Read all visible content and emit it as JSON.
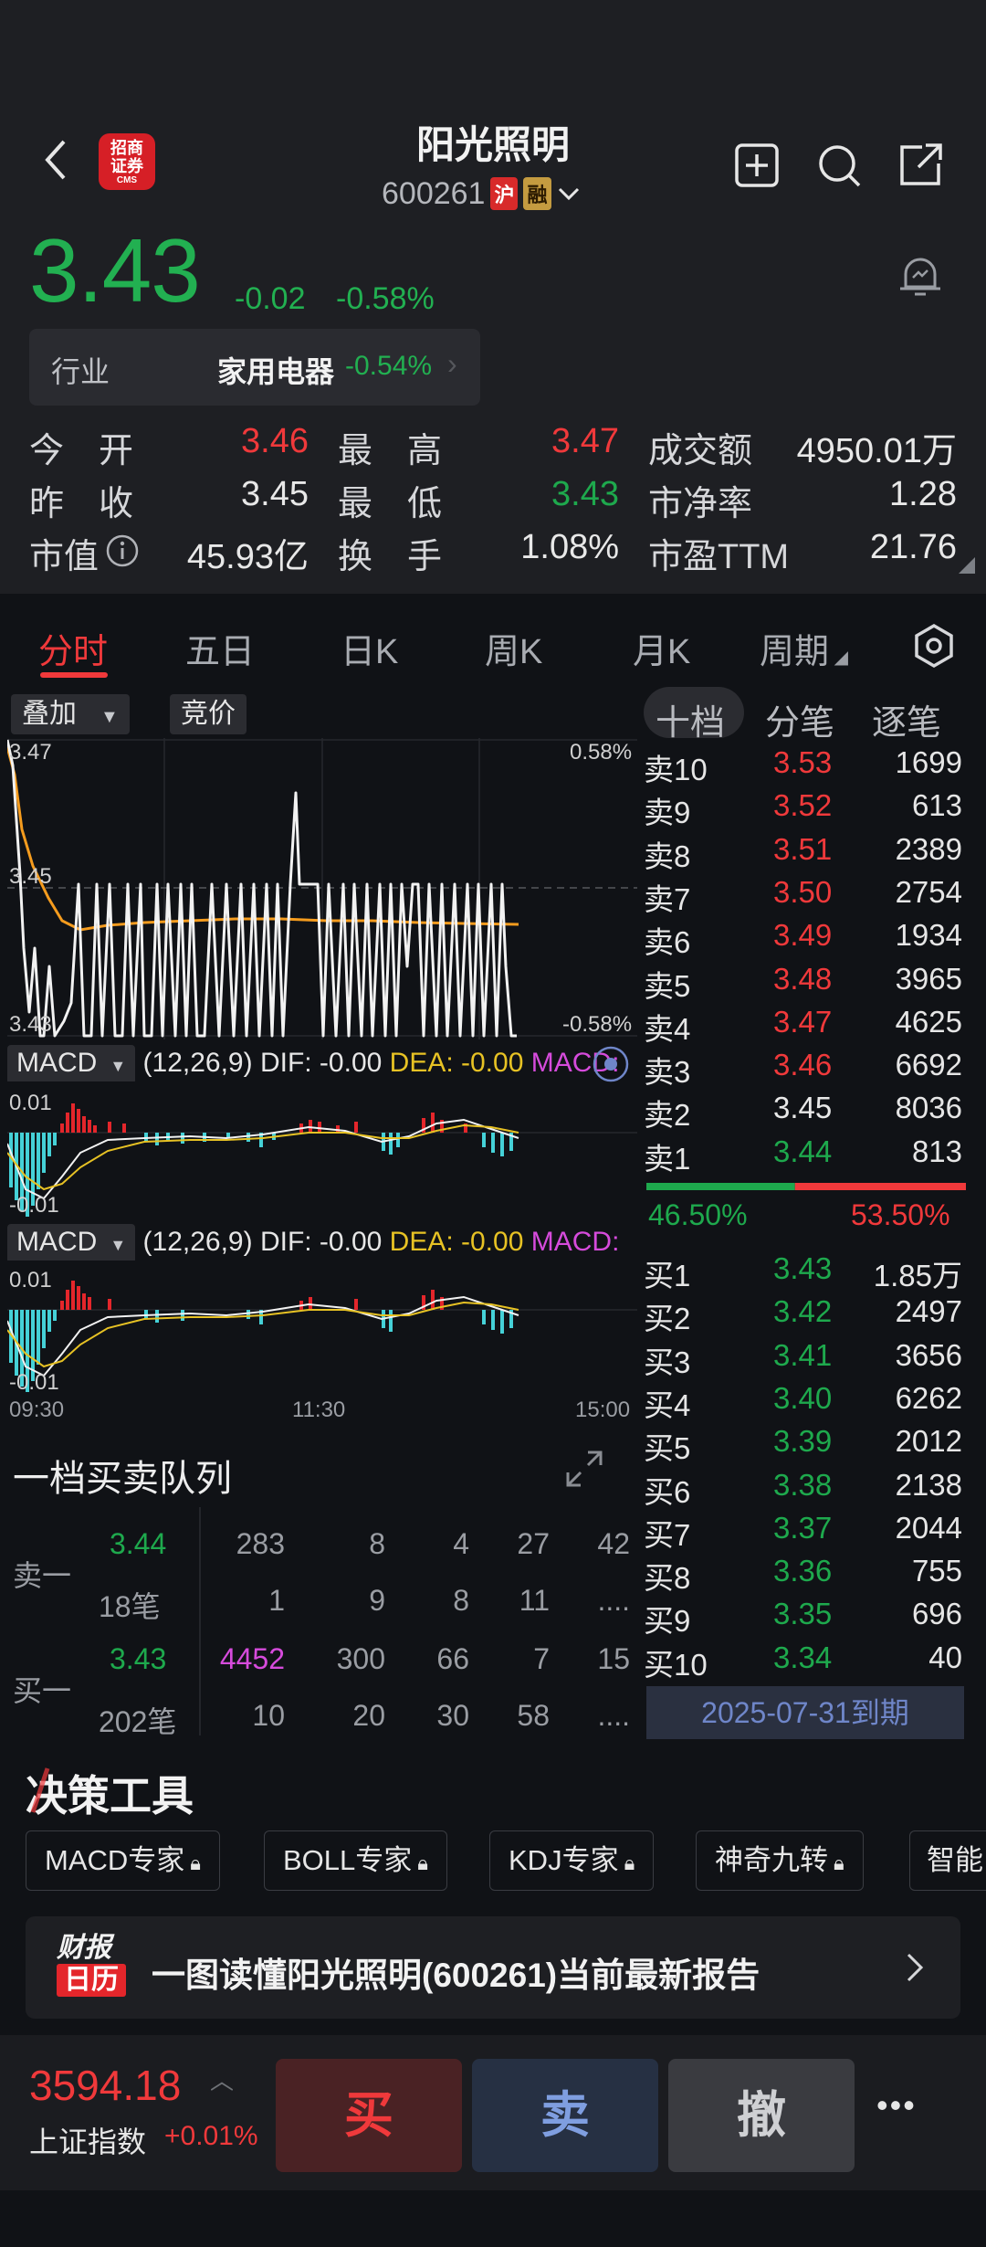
{
  "header": {
    "stock_name": "阳光照明",
    "stock_code": "600261",
    "tag_market": "沪",
    "tag_margin": "融",
    "logo_text": "招商证券",
    "logo_sub": "CMS"
  },
  "quote": {
    "price": "3.43",
    "change": "-0.02",
    "change_pct": "-0.58%",
    "industry_label": "行业",
    "industry_name": "家用电器",
    "industry_change": "-0.54%",
    "rows": [
      {
        "l1": "今　开",
        "v1": "3.46",
        "l2": "最　高",
        "v2": "3.47",
        "l3": "成交额",
        "v3": "4950.01万"
      },
      {
        "l1": "昨　收",
        "v1": "3.45",
        "l2": "最　低",
        "v2": "3.43",
        "l3": "市净率",
        "v3": "1.28"
      },
      {
        "l1": "市值",
        "v1": "45.93亿",
        "l2": "换　手",
        "v2": "1.08%",
        "l3": "市盈TTM",
        "v3": "21.76"
      }
    ]
  },
  "tabs": [
    "分时",
    "五日",
    "日K",
    "周K",
    "月K",
    "周期"
  ],
  "chart": {
    "overlay_label": "叠加",
    "auction_label": "竞价",
    "y_top": "3.47",
    "y_mid": "3.45",
    "y_bottom": "3.43",
    "pct_top": "0.58%",
    "pct_bottom": "-0.58%",
    "macd_label": "MACD",
    "macd_params": "(12,26,9)",
    "dif": "DIF: -0.00",
    "dea": "DEA: -0.00",
    "macd_val": "MACD:",
    "macd_top": "0.01",
    "macd_bottom": "-0.01",
    "time_start": "09:30",
    "time_mid": "11:30",
    "time_end": "15:00"
  },
  "orderbook": {
    "tabs": [
      "十档",
      "分笔",
      "逐笔"
    ],
    "sells": [
      {
        "label": "卖10",
        "price": "3.53",
        "vol": "1699"
      },
      {
        "label": "卖9",
        "price": "3.52",
        "vol": "613"
      },
      {
        "label": "卖8",
        "price": "3.51",
        "vol": "2389"
      },
      {
        "label": "卖7",
        "price": "3.50",
        "vol": "2754"
      },
      {
        "label": "卖6",
        "price": "3.49",
        "vol": "1934"
      },
      {
        "label": "卖5",
        "price": "3.48",
        "vol": "3965"
      },
      {
        "label": "卖4",
        "price": "3.47",
        "vol": "4625"
      },
      {
        "label": "卖3",
        "price": "3.46",
        "vol": "6692"
      },
      {
        "label": "卖2",
        "price": "3.45",
        "vol": "8036"
      },
      {
        "label": "卖1",
        "price": "3.44",
        "vol": "813"
      }
    ],
    "buy_ratio": "46.50%",
    "sell_ratio": "53.50%",
    "buy_ratio_value": 0.465,
    "buys": [
      {
        "label": "买1",
        "price": "3.43",
        "vol": "1.85万"
      },
      {
        "label": "买2",
        "price": "3.42",
        "vol": "2497"
      },
      {
        "label": "买3",
        "price": "3.41",
        "vol": "3656"
      },
      {
        "label": "买4",
        "price": "3.40",
        "vol": "6262"
      },
      {
        "label": "买5",
        "price": "3.39",
        "vol": "2012"
      },
      {
        "label": "买6",
        "price": "3.38",
        "vol": "2138"
      },
      {
        "label": "买7",
        "price": "3.37",
        "vol": "2044"
      },
      {
        "label": "买8",
        "price": "3.36",
        "vol": "755"
      },
      {
        "label": "买9",
        "price": "3.35",
        "vol": "696"
      },
      {
        "label": "买10",
        "price": "3.34",
        "vol": "40"
      }
    ],
    "expiry": "2025-07-31到期"
  },
  "queue": {
    "title": "一档买卖队列",
    "sell_label": "卖一",
    "sell_price": "3.44",
    "sell_row1": [
      "283",
      "8",
      "4",
      "27",
      "42"
    ],
    "sell_count": "18笔",
    "sell_row2": [
      "1",
      "9",
      "8",
      "11",
      "...."
    ],
    "buy_label": "买一",
    "buy_price": "3.43",
    "buy_row1": [
      "4452",
      "300",
      "66",
      "7",
      "15"
    ],
    "buy_count": "202笔",
    "buy_row2": [
      "10",
      "20",
      "30",
      "58",
      "...."
    ]
  },
  "tools": {
    "title": "决策工具",
    "chips": [
      "MACD专家",
      "BOLL专家",
      "KDJ专家",
      "神奇九转",
      "智能"
    ],
    "banner_logo_top": "财报",
    "banner_logo_bottom": "日历",
    "banner_text": "一图读懂阳光照明(600261)当前最新报告"
  },
  "bottom": {
    "index_value": "3594.18",
    "index_name": "上证指数",
    "index_change": "+0.01%",
    "buy_label": "买",
    "sell_label": "卖",
    "cancel_label": "撤",
    "more_label": "•••"
  },
  "colors": {
    "up": "#f0393b",
    "down": "#1ea94d",
    "background": "#101216"
  }
}
